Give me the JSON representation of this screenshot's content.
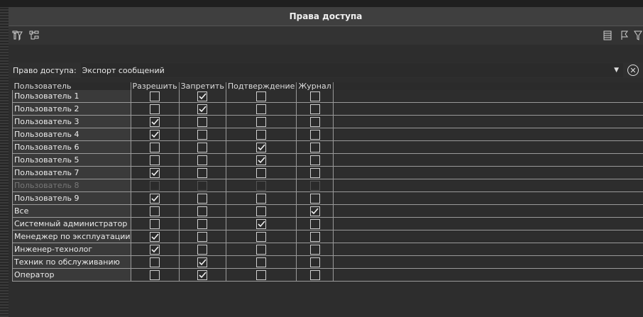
{
  "window": {
    "title": "Права доступа"
  },
  "toolbar": {
    "left_icons": [
      "sort-filter-icon",
      "hierarchy-icon"
    ],
    "right_icons": [
      "list-view-icon",
      "flag-icon",
      "filter-icon"
    ]
  },
  "filter": {
    "label": "Право доступа:",
    "value": "Экспорт сообщений"
  },
  "table": {
    "columns": [
      "Пользователь",
      "Разрешить",
      "Запретить",
      "Подтверждение",
      "Журнал"
    ],
    "rows": [
      {
        "name": "Пользователь 1",
        "checks": [
          false,
          true,
          false,
          false
        ],
        "disabled": false
      },
      {
        "name": "Пользователь 2",
        "checks": [
          false,
          true,
          false,
          false
        ],
        "disabled": false
      },
      {
        "name": "Пользователь 3",
        "checks": [
          true,
          false,
          false,
          false
        ],
        "disabled": false
      },
      {
        "name": "Пользователь 4",
        "checks": [
          true,
          false,
          false,
          false
        ],
        "disabled": false
      },
      {
        "name": "Пользователь 6",
        "checks": [
          false,
          false,
          true,
          false
        ],
        "disabled": false
      },
      {
        "name": "Пользователь 5",
        "checks": [
          false,
          false,
          true,
          false
        ],
        "disabled": false
      },
      {
        "name": "Пользователь 7",
        "checks": [
          true,
          false,
          false,
          false
        ],
        "disabled": false
      },
      {
        "name": "Пользователь 8",
        "checks": [
          false,
          false,
          false,
          false
        ],
        "disabled": true
      },
      {
        "name": "Пользователь 9",
        "checks": [
          true,
          false,
          false,
          false
        ],
        "disabled": false
      },
      {
        "name": "Все",
        "checks": [
          false,
          false,
          false,
          true
        ],
        "disabled": false
      },
      {
        "name": "Системный администратор",
        "checks": [
          false,
          false,
          true,
          false
        ],
        "disabled": false
      },
      {
        "name": "Менеджер по эксплуатации",
        "checks": [
          true,
          false,
          false,
          false
        ],
        "disabled": false
      },
      {
        "name": "Инженер-технолог",
        "checks": [
          true,
          false,
          false,
          false
        ],
        "disabled": false
      },
      {
        "name": "Техник по обслуживанию",
        "checks": [
          false,
          true,
          false,
          false
        ],
        "disabled": false
      },
      {
        "name": "Оператор",
        "checks": [
          false,
          true,
          false,
          false
        ],
        "disabled": false
      }
    ]
  }
}
